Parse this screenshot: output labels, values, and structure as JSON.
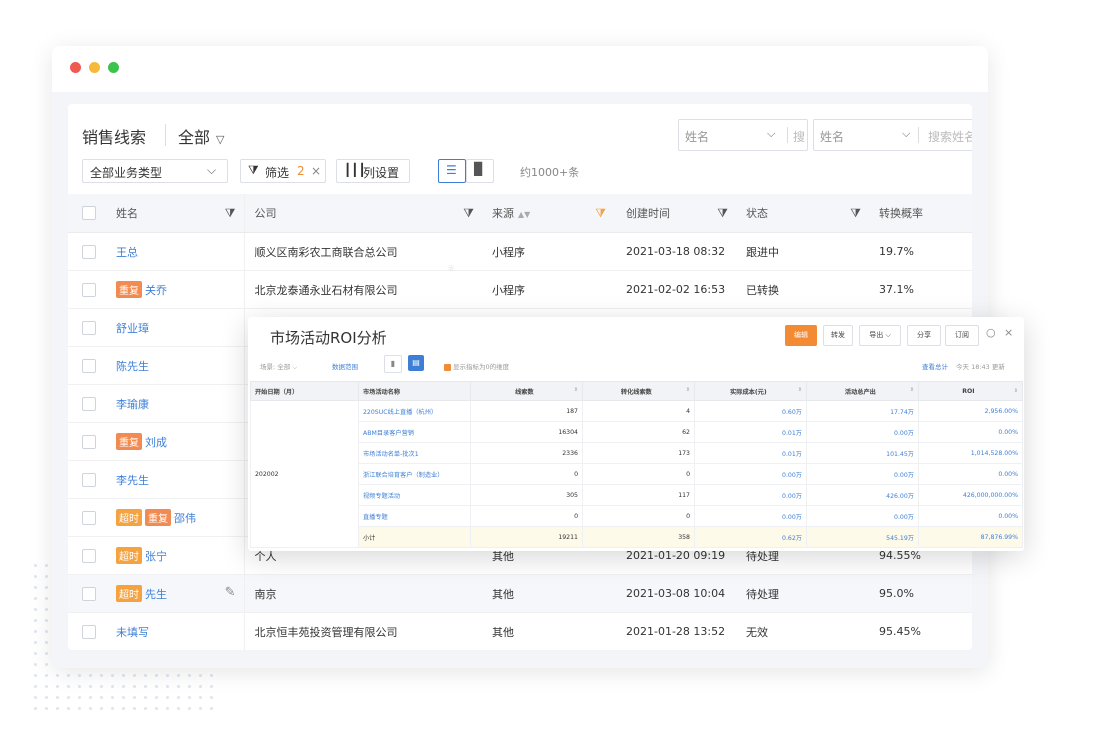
{
  "header": {
    "title": "销售线索",
    "scope": "全部"
  },
  "search": [
    {
      "label": "姓名",
      "placeholder": "搜"
    },
    {
      "label": "姓名",
      "placeholder": "搜索姓名"
    }
  ],
  "toolbar": {
    "business_type": "全部业务类型",
    "filter_label": "筛选",
    "filter_count": "2",
    "columns_label": "列设置",
    "count_text": "约1000+条"
  },
  "table": {
    "columns": [
      "姓名",
      "公司",
      "来源",
      "创建时间",
      "状态",
      "转换概率"
    ],
    "rows": [
      {
        "tags": [],
        "name": "王总",
        "company": "顺义区南彩农工商联合总公司",
        "source": "小程序",
        "time": "2021-03-18 08:32",
        "status": "跟进中",
        "rate": "19.7%"
      },
      {
        "tags": [
          "重复"
        ],
        "name": "关乔",
        "company": "北京龙泰通永业石材有限公司",
        "source": "小程序",
        "time": "2021-02-02 16:53",
        "status": "已转换",
        "rate": "37.1%"
      },
      {
        "tags": [],
        "name": "舒业璋",
        "company": "",
        "source": "",
        "time": "",
        "status": "",
        "rate": ""
      },
      {
        "tags": [],
        "name": "陈先生",
        "company": "",
        "source": "",
        "time": "",
        "status": "",
        "rate": ""
      },
      {
        "tags": [],
        "name": "李瑜康",
        "company": "",
        "source": "",
        "time": "",
        "status": "",
        "rate": ""
      },
      {
        "tags": [
          "重复"
        ],
        "name": "刘成",
        "company": "",
        "source": "",
        "time": "",
        "status": "",
        "rate": ""
      },
      {
        "tags": [],
        "name": "李先生",
        "company": "",
        "source": "",
        "time": "",
        "status": "",
        "rate": ""
      },
      {
        "tags": [
          "超时",
          "重复"
        ],
        "name": "邵伟",
        "company": "",
        "source": "",
        "time": "",
        "status": "",
        "rate": ""
      },
      {
        "tags": [
          "超时"
        ],
        "name": "张宁",
        "company": "个人",
        "source": "其他",
        "time": "2021-01-20 09:19",
        "status": "待处理",
        "rate": "94.55%"
      },
      {
        "tags": [
          "超时"
        ],
        "name": "先生",
        "company": "南京",
        "source": "其他",
        "time": "2021-03-08 10:04",
        "status": "待处理",
        "rate": "95.0%"
      },
      {
        "tags": [],
        "name": "未填写",
        "company": "北京恒丰苑投资管理有限公司",
        "source": "其他",
        "time": "2021-01-28 13:52",
        "status": "无效",
        "rate": "95.45%"
      }
    ]
  },
  "popup": {
    "title": "市场活动ROI分析",
    "buttons": [
      "编辑",
      "转发",
      "导出",
      "分享",
      "订阅"
    ],
    "filter_label": "场景:",
    "filter_value": "全部",
    "range_label": "数据范围",
    "checkbox_label": "显示指标为0的维度",
    "view_summary": "查看总计",
    "updated": "今天 18:43 更新",
    "columns": [
      "开始日期（月）",
      "市场活动名称",
      "线索数",
      "转化线索数",
      "实际成本(元)",
      "活动总产出",
      "ROI"
    ],
    "group_label": "202002",
    "rows": [
      [
        "220SUC线上直播（杭州）",
        "187",
        "4",
        "0.60万",
        "17.74万",
        "2,956.00%"
      ],
      [
        "ABM目录客户营销",
        "16304",
        "62",
        "0.01万",
        "0.00万",
        "0.00%"
      ],
      [
        "市场活动名单-批次1",
        "2336",
        "173",
        "0.01万",
        "101.45万",
        "1,014,528.00%"
      ],
      [
        "浙江联合培育客户（制造业）",
        "0",
        "0",
        "0.00万",
        "0.00万",
        "0.00%"
      ],
      [
        "视频专题活动",
        "305",
        "117",
        "0.00万",
        "426.00万",
        "426,000,000.00%"
      ],
      [
        "直播专题",
        "0",
        "0",
        "0.00万",
        "0.00万",
        "0.00%"
      ]
    ],
    "subtotal": [
      "小计",
      "19211",
      "358",
      "0.62万",
      "545.19万",
      "87,876.99%"
    ]
  },
  "colors": {
    "accent": "#3d7fd6",
    "orange": "#f28b33",
    "tag_repeat": "#f28b52",
    "tag_timeout": "#f4a340"
  }
}
